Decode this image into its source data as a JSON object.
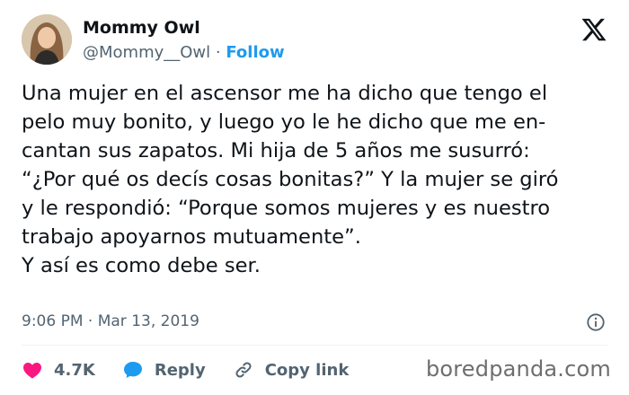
{
  "author": {
    "display_name": "Mommy Owl",
    "handle": "@Mommy__Owl",
    "separator": "·",
    "follow_label": "Follow"
  },
  "tweet": {
    "lines": [
      "Una mujer en el ascensor me ha dicho que tengo el",
      "pelo muy bonito, y luego yo le he dicho que me en-",
      "cantan sus zapatos. Mi hija de 5 años me susurró:",
      "“¿Por qué os decís cosas bonitas?” Y la mujer se giró",
      "y le respondió: “Porque somos mujeres y es nuestro",
      "trabajo apoyarnos mutuamente”.",
      "Y así es como debe ser."
    ],
    "timestamp": "9:06 PM · Mar 13, 2019"
  },
  "actions": {
    "likes": "4.7K",
    "reply_label": "Reply",
    "copy_link_label": "Copy link"
  },
  "icons": {
    "platform": "x-logo-icon",
    "like": "heart-icon",
    "reply": "speech-bubble-icon",
    "copy": "link-icon",
    "info": "info-icon"
  },
  "colors": {
    "like": "#f91880",
    "reply": "#1d9bf0",
    "follow": "#1d9bf0",
    "secondary_text": "#536471"
  },
  "watermark": "boredpanda.com"
}
